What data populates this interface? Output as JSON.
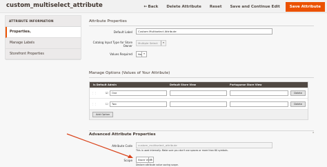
{
  "header": {
    "title": "custom_multiselect_attribute",
    "back_label": "Back",
    "delete_label": "Delete Attribute",
    "reset_label": "Reset",
    "save_continue_label": "Save and Continue Edit",
    "save_label": "Save Attribute",
    "accent_color": "#eb5202"
  },
  "sidebar": {
    "title": "ATTRIBUTE INFORMATION",
    "items": [
      {
        "label": "Properties",
        "active": true
      },
      {
        "label": "Manage Labels",
        "active": false
      },
      {
        "label": "Storefront Properties",
        "active": false
      }
    ]
  },
  "properties": {
    "section_title": "Attribute Properties",
    "default_label_label": "Default Label",
    "default_label_value": "Custom Multiselect Attribute",
    "catalog_input_label_1": "Catalog Input Type for Store",
    "catalog_input_label_2": "Owner",
    "catalog_input_value": "Multiple Select",
    "values_required_label": "Values Required",
    "values_required_value": "No"
  },
  "options": {
    "section_title": "Manage Options (Values of Your Attribute)",
    "columns": [
      "Is Default",
      "Admin",
      "Default Store View",
      "Portuguese Store View"
    ],
    "rows": [
      {
        "admin": "One",
        "default_store": "",
        "portuguese": "",
        "delete_label": "Delete"
      },
      {
        "admin": "Two",
        "default_store": "",
        "portuguese": "",
        "delete_label": "Delete"
      }
    ],
    "add_label": "Add Option"
  },
  "advanced": {
    "section_title": "Advanced Attribute Properties",
    "code_label": "Attribute Code",
    "code_value": "custom_multiselect_attribute",
    "code_note": "This is used internally. Make sure you don't use spaces or more than 60 symbols.",
    "scope_label": "Scope",
    "scope_value": "Store View",
    "scope_note": "Declare attribute value saving scope."
  },
  "annotation": {
    "arrow_color": "#d9441c"
  }
}
